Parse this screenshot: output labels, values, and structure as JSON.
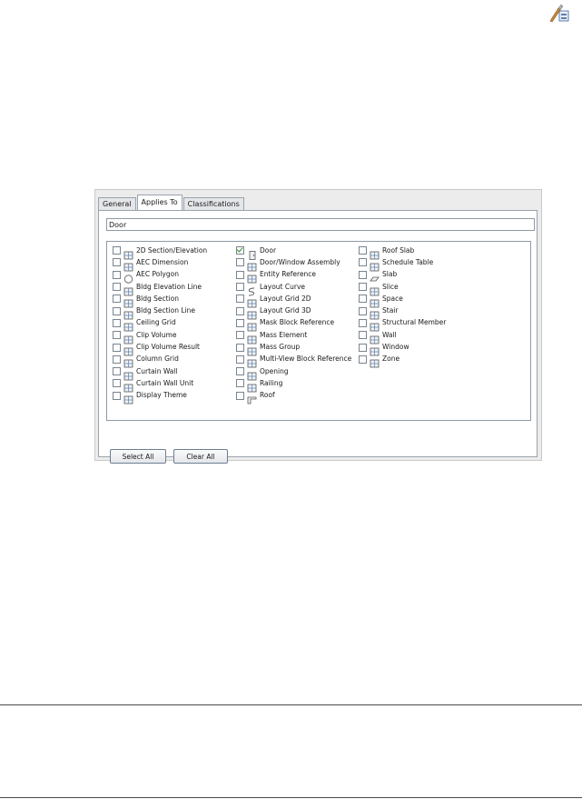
{
  "tabs": [
    "General",
    "Applies To",
    "Classifications"
  ],
  "active_tab": "Applies To",
  "name_field": {
    "value": "Door"
  },
  "columns": [
    [
      {
        "label": "2D Section/Elevation",
        "icon": "section-elevation-icon",
        "checked": false
      },
      {
        "label": "AEC Dimension",
        "icon": "dimension-icon",
        "checked": false
      },
      {
        "label": "AEC Polygon",
        "icon": "polygon-icon",
        "checked": false
      },
      {
        "label": "Bldg Elevation Line",
        "icon": "elevation-line-icon",
        "checked": false
      },
      {
        "label": "Bldg Section",
        "icon": "bldg-section-icon",
        "checked": false
      },
      {
        "label": "Bldg Section Line",
        "icon": "section-line-icon",
        "checked": false
      },
      {
        "label": "Ceiling Grid",
        "icon": "ceiling-grid-icon",
        "checked": false
      },
      {
        "label": "Clip Volume",
        "icon": "clip-volume-icon",
        "checked": false
      },
      {
        "label": "Clip Volume Result",
        "icon": "clip-volume-result-icon",
        "checked": false
      },
      {
        "label": "Column Grid",
        "icon": "column-grid-icon",
        "checked": false
      },
      {
        "label": "Curtain Wall",
        "icon": "curtain-wall-icon",
        "checked": false
      },
      {
        "label": "Curtain Wall Unit",
        "icon": "curtain-wall-unit-icon",
        "checked": false
      },
      {
        "label": "Display Theme",
        "icon": "display-theme-icon",
        "checked": false
      }
    ],
    [
      {
        "label": "Door",
        "icon": "door-icon",
        "checked": true
      },
      {
        "label": "Door/Window Assembly",
        "icon": "door-window-assembly-icon",
        "checked": false
      },
      {
        "label": "Entity Reference",
        "icon": "entity-reference-icon",
        "checked": false
      },
      {
        "label": "Layout Curve",
        "icon": "layout-curve-icon",
        "checked": false
      },
      {
        "label": "Layout Grid 2D",
        "icon": "layout-grid-2d-icon",
        "checked": false
      },
      {
        "label": "Layout Grid 3D",
        "icon": "layout-grid-3d-icon",
        "checked": false
      },
      {
        "label": "Mask Block Reference",
        "icon": "mask-block-icon",
        "checked": false
      },
      {
        "label": "Mass Element",
        "icon": "mass-element-icon",
        "checked": false
      },
      {
        "label": "Mass Group",
        "icon": "mass-group-icon",
        "checked": false
      },
      {
        "label": "Multi-View Block Reference",
        "icon": "multi-view-block-icon",
        "checked": false
      },
      {
        "label": "Opening",
        "icon": "opening-icon",
        "checked": false
      },
      {
        "label": "Railing",
        "icon": "railing-icon",
        "checked": false
      },
      {
        "label": "Roof",
        "icon": "roof-icon",
        "checked": false
      }
    ],
    [
      {
        "label": "Roof Slab",
        "icon": "roof-slab-icon",
        "checked": false
      },
      {
        "label": "Schedule Table",
        "icon": "schedule-table-icon",
        "checked": false
      },
      {
        "label": "Slab",
        "icon": "slab-icon",
        "checked": false
      },
      {
        "label": "Slice",
        "icon": "slice-icon",
        "checked": false
      },
      {
        "label": "Space",
        "icon": "space-icon",
        "checked": false
      },
      {
        "label": "Stair",
        "icon": "stair-icon",
        "checked": false
      },
      {
        "label": "Structural Member",
        "icon": "structural-member-icon",
        "checked": false
      },
      {
        "label": "Wall",
        "icon": "wall-icon",
        "checked": false
      },
      {
        "label": "Window",
        "icon": "window-icon",
        "checked": false
      },
      {
        "label": "Zone",
        "icon": "zone-icon",
        "checked": false
      }
    ]
  ],
  "buttons": {
    "select_all": "Select All",
    "clear_all": "Clear All"
  },
  "colors": {
    "border": "#9aa3ad",
    "check": "#2a8a2a",
    "icon_blue": "#5b7fb0"
  }
}
